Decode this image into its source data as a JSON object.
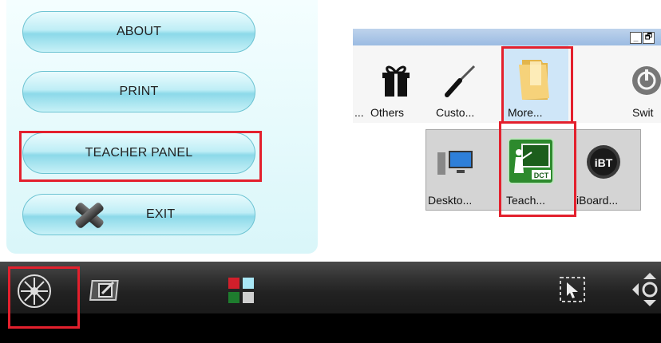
{
  "menu": {
    "items": [
      {
        "label": "ABOUT"
      },
      {
        "label": "PRINT"
      },
      {
        "label": "TEACHER PANEL"
      },
      {
        "label": "EXIT",
        "icon": "x-icon"
      }
    ]
  },
  "window": {
    "controls": [
      "_",
      "🗗"
    ],
    "items": [
      {
        "label": "...",
        "icon": "ellipsis"
      },
      {
        "label": "Others",
        "icon": "gift-icon"
      },
      {
        "label": "Custo...",
        "icon": "screwdriver-icon"
      },
      {
        "label": "More...",
        "icon": "folder-icon"
      },
      {
        "label": "Swit",
        "icon": "power-switch-icon"
      }
    ]
  },
  "launcher": {
    "items": [
      {
        "label": "Deskto...",
        "icon": "desktop-icon"
      },
      {
        "label": "Teach...",
        "icon": "teacher-board-icon",
        "badge": "DCT"
      },
      {
        "label": "iBoard...",
        "icon": "iboard-icon",
        "badge": "iBT"
      }
    ]
  },
  "toolbar": {
    "items": [
      "compass-menu-icon",
      "pen-window-icon",
      "color-palette-icon",
      "selection-arrow-icon",
      "move-arrows-icon"
    ]
  },
  "colors": {
    "highlight": "#e3202d",
    "panel_bg": "#e6f9fb",
    "pill_border": "#6cc3d2",
    "toolbar_bg": "#2a2a2a",
    "titlebar": "#aac6e6"
  }
}
